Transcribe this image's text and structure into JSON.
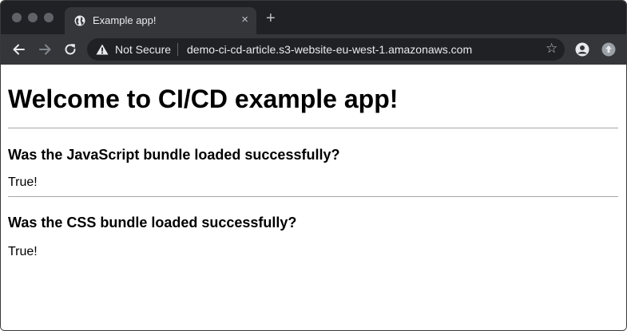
{
  "browser": {
    "tab_title": "Example app!",
    "tab_close": "×",
    "new_tab": "+",
    "security_label": "Not Secure",
    "url": "demo-ci-cd-article.s3-website-eu-west-1.amazonaws.com",
    "bookmark_glyph": "☆",
    "icons": [
      "back-arrow-icon",
      "forward-arrow-icon",
      "reload-icon",
      "warning-icon",
      "star-icon",
      "profile-icon",
      "extension-icon",
      "globe-icon"
    ]
  },
  "page": {
    "heading": "Welcome to CI/CD example app!",
    "sections": [
      {
        "question": "Was the JavaScript bundle loaded successfully?",
        "answer": "True!"
      },
      {
        "question": "Was the CSS bundle loaded successfully?",
        "answer": "True!"
      }
    ]
  }
}
